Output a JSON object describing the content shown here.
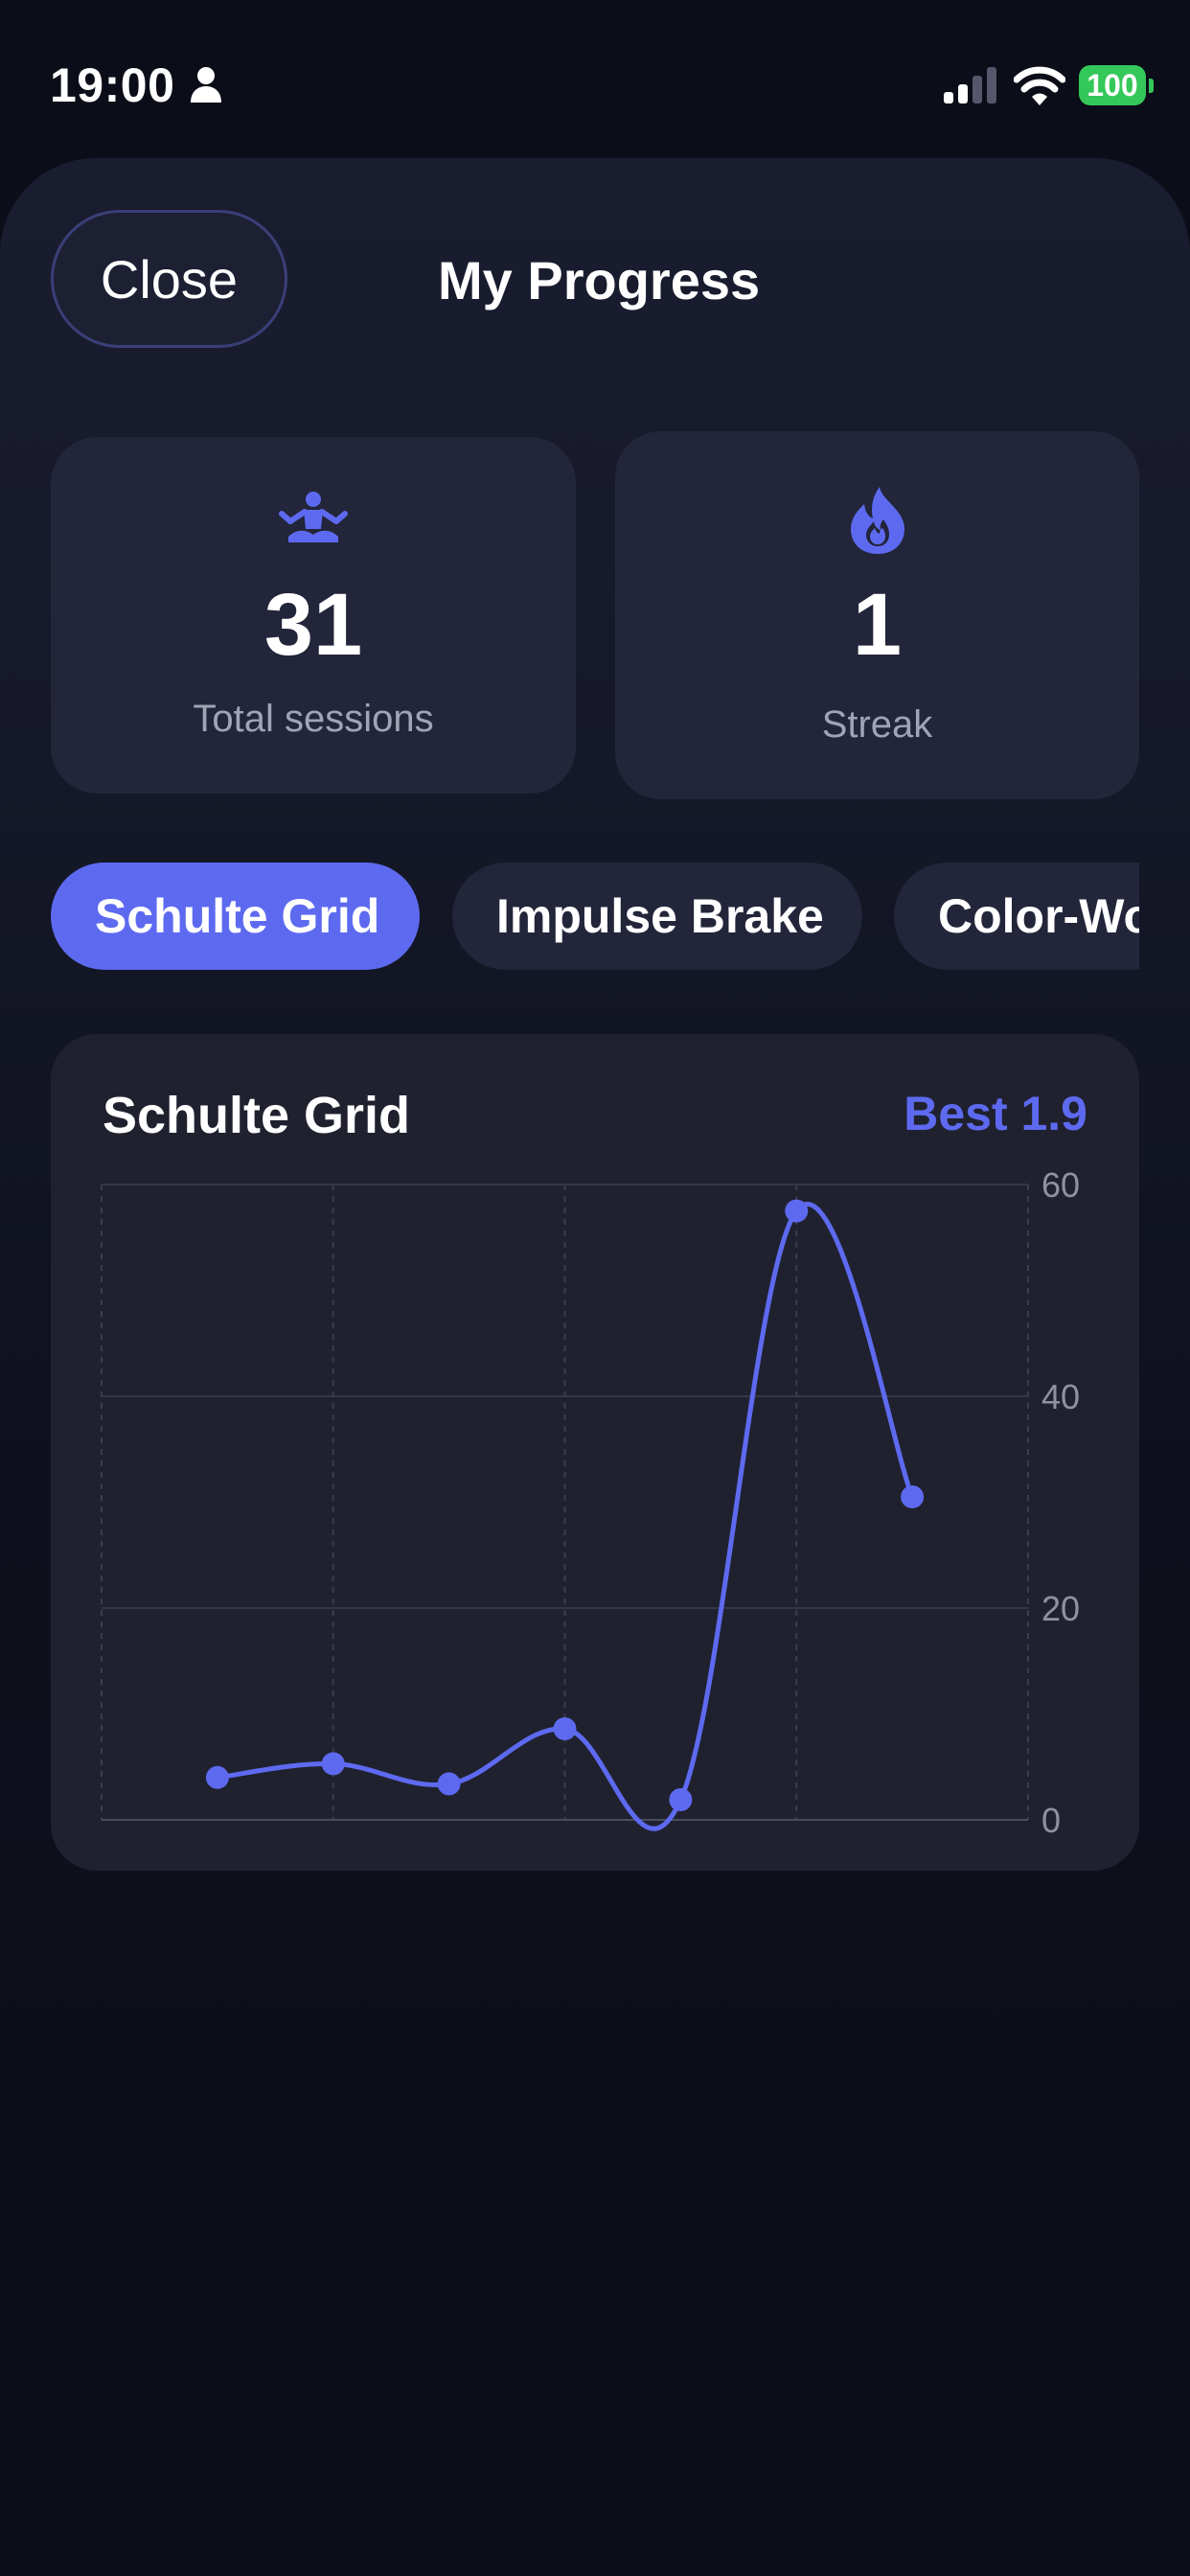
{
  "status_bar": {
    "time": "19:00",
    "battery": "100",
    "icons": [
      "person-icon",
      "signal-icon",
      "wifi-icon",
      "battery-icon"
    ]
  },
  "header": {
    "close_label": "Close",
    "title": "My Progress"
  },
  "stats": {
    "sessions": {
      "icon": "meditation-icon",
      "value": "31",
      "label": "Total sessions"
    },
    "streak": {
      "icon": "flame-icon",
      "value": "1",
      "label": "Streak"
    }
  },
  "tabs": [
    {
      "label": "Schulte Grid",
      "active": true
    },
    {
      "label": "Impulse Brake",
      "active": false
    },
    {
      "label": "Color-Word",
      "active": false
    }
  ],
  "chart_panel": {
    "title": "Schulte Grid",
    "best": "Best 1.9"
  },
  "colors": {
    "accent": "#5d6af0",
    "background": "#0b0d18",
    "card": "#23253a",
    "muted_text": "#a1a3b6",
    "battery_green": "#34c759"
  },
  "chart_data": {
    "type": "line",
    "x": [
      1,
      2,
      3,
      4,
      5,
      6,
      7
    ],
    "series": [
      {
        "values": [
          4,
          5.3,
          3.4,
          8.6,
          1.9,
          57.5,
          30.5
        ]
      }
    ],
    "y_ticks": [
      "0",
      "20",
      "40",
      "60"
    ],
    "ylim": [
      0,
      60
    ],
    "grid": true,
    "y_axis_position": "right",
    "curve": "smooth"
  }
}
